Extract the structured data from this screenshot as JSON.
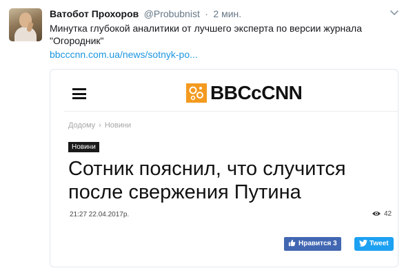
{
  "tweet": {
    "author_name": "Ватобот Прохоров",
    "author_handle": "@Probubnist",
    "separator": "·",
    "time": "2 мин.",
    "text": "Минутка глубокой аналитики от лучшего эксперта по версии журнала \"Огородник\"",
    "link": "bbcccnn.com.ua/news/sotnyk-po..."
  },
  "card": {
    "logo_text": "BBCcCNN",
    "breadcrumb": [
      "Додому",
      "Новини"
    ],
    "breadcrumb_separator": "›",
    "category": "Новини",
    "headline": "Сотник пояснил, что случится после свержения Путина",
    "date": "21:27 22.04.2017р.",
    "views": "42",
    "like_label": "Нравится 3",
    "tweet_label": "Tweet"
  },
  "colors": {
    "link": "#1b95e0",
    "facebook": "#4267b2",
    "twitter": "#1da1f2",
    "logo_orange": "#f39a1f"
  },
  "icons": [
    "chevron-down-icon",
    "hamburger-menu-icon",
    "logo-gears-icon",
    "eye-icon",
    "thumbs-up-icon",
    "twitter-bird-icon"
  ]
}
